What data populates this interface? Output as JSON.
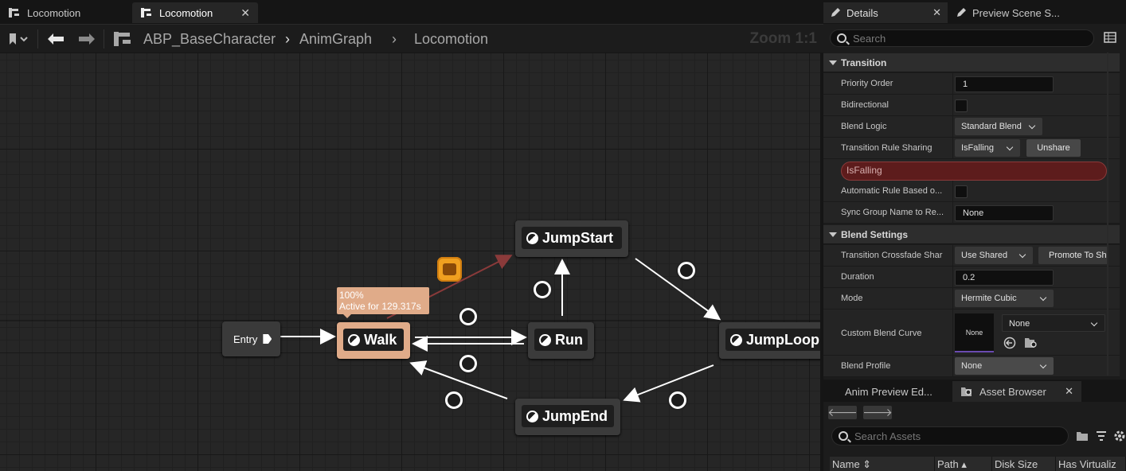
{
  "tabs": [
    {
      "label": "Locomotion",
      "active": false
    },
    {
      "label": "Locomotion",
      "active": true
    }
  ],
  "breadcrumb": {
    "items": [
      "ABP_BaseCharacter",
      "AnimGraph",
      "Locomotion"
    ],
    "zoom": "Zoom 1:1"
  },
  "graph": {
    "entry_label": "Entry",
    "states": [
      "Walk",
      "Run",
      "JumpStart",
      "JumpLoop",
      "JumpEnd"
    ],
    "active_tooltip": {
      "line1": "100%",
      "line2": "Active for 129.317s"
    }
  },
  "details": {
    "tab_label": "Details",
    "tab2_label": "Preview Scene S...",
    "search_placeholder": "Search",
    "section_transition": "Transition",
    "priority_order_label": "Priority Order",
    "priority_order_value": "1",
    "bidirectional_label": "Bidirectional",
    "blend_logic_label": "Blend Logic",
    "blend_logic_value": "Standard Blend",
    "rule_sharing_label": "Transition Rule Sharing",
    "rule_sharing_value": "IsFalling",
    "unshare_label": "Unshare",
    "rule_bar_text": "IsFalling",
    "auto_rule_label": "Automatic Rule Based o...",
    "sync_group_label": "Sync Group Name to Re...",
    "sync_group_value": "None",
    "section_blend": "Blend Settings",
    "crossfade_label": "Transition Crossfade Shar",
    "crossfade_value": "Use Shared",
    "promote_label": "Promote To Sh",
    "duration_label": "Duration",
    "duration_value": "0.2",
    "mode_label": "Mode",
    "mode_value": "Hermite Cubic",
    "curve_label": "Custom Blend Curve",
    "curve_thumb": "None",
    "curve_value": "None",
    "profile_label": "Blend Profile",
    "profile_value": "None"
  },
  "assets": {
    "tab1_label": "Anim Preview Ed...",
    "tab2_label": "Asset Browser",
    "search_placeholder": "Search Assets",
    "columns": [
      "Name",
      "Path",
      "Disk Size",
      "Has Virtualiz"
    ]
  },
  "colors": {
    "active_state": "#e0ab89",
    "rule_error": "#5d1c1c",
    "warning": "#f0a020"
  }
}
